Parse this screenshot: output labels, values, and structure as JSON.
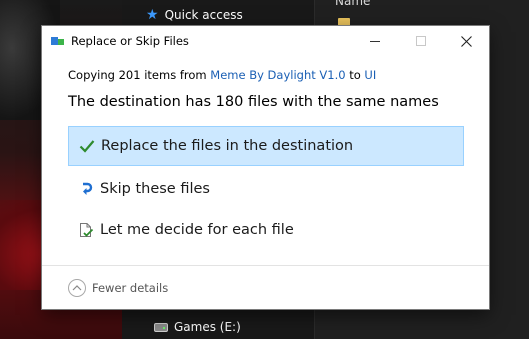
{
  "background": {
    "quick_access": "Quick access",
    "column_header": "Name",
    "drive_label": "Games (E:)"
  },
  "dialog": {
    "title": "Replace or Skip Files",
    "copying": {
      "prefix": "Copying 201 items from ",
      "source": "Meme By Daylight V1.0",
      "middle": " to ",
      "destination": "UI"
    },
    "headline": "The destination has 180 files with the same names",
    "options": [
      {
        "label": "Replace the files in the destination",
        "icon": "checkmark-icon",
        "selected": true
      },
      {
        "label": "Skip these files",
        "icon": "skip-arrow-icon",
        "selected": false
      },
      {
        "label": "Let me decide for each file",
        "icon": "decide-file-icon",
        "selected": false
      }
    ],
    "footer": {
      "toggle_label": "Fewer details",
      "icon": "chevron-up-icon"
    }
  },
  "colors": {
    "selected_bg": "#cce8ff",
    "selected_border": "#99d1ff",
    "link": "#1a5fb4",
    "check": "#2e8b2e",
    "skip_arrow": "#1f6fd1"
  }
}
